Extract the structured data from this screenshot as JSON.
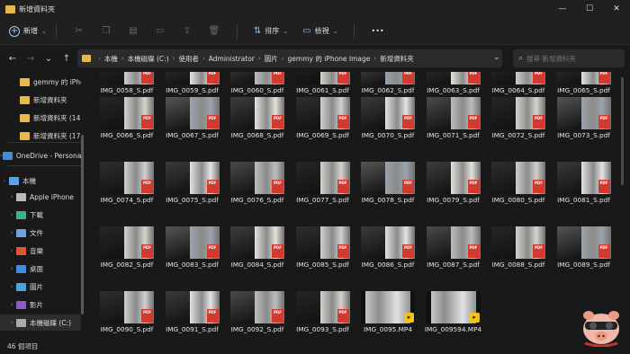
{
  "window": {
    "title": "新增資料夾",
    "minimize": "—",
    "maximize": "☐",
    "close": "✕"
  },
  "toolbar": {
    "new_label": "新增",
    "sort_label": "排序",
    "view_label": "檢視",
    "more_label": "•••"
  },
  "address": {
    "crumbs": [
      "本機",
      "本機磁碟 (C:)",
      "使用者",
      "Administrator",
      "圖片",
      "gemmy 的 iPhone Image",
      "新增資料夾"
    ],
    "search_placeholder": "搜尋 新增資料夾"
  },
  "sidebar": {
    "items": [
      {
        "label": "gemmy 的 iPhone",
        "icon": "folder-icon",
        "color": "#e8b94a"
      },
      {
        "label": "新增資料夾",
        "icon": "folder-icon",
        "color": "#e8b94a"
      },
      {
        "label": "新增資料夾 (14)",
        "icon": "folder-icon",
        "color": "#e8b94a"
      },
      {
        "label": "新增資料夾 (17)",
        "icon": "folder-icon",
        "color": "#e8b94a"
      },
      {
        "label": "OneDrive - Personal",
        "icon": "cloud-icon",
        "color": "#3d8ee0"
      },
      {
        "label": "本機",
        "icon": "pc-icon",
        "color": "#5aa4e6"
      },
      {
        "label": "Apple iPhone",
        "icon": "phone-icon",
        "color": "#bbbbbb"
      },
      {
        "label": "下載",
        "icon": "download-icon",
        "color": "#3fb08a"
      },
      {
        "label": "文件",
        "icon": "document-icon",
        "color": "#6ea2d8"
      },
      {
        "label": "音樂",
        "icon": "music-icon",
        "color": "#e0533d"
      },
      {
        "label": "桌面",
        "icon": "desktop-icon",
        "color": "#3d8ee0"
      },
      {
        "label": "圖片",
        "icon": "pictures-icon",
        "color": "#4aa3e0"
      },
      {
        "label": "影片",
        "icon": "video-icon",
        "color": "#8b5cc8"
      },
      {
        "label": "本機磁碟 (C:)",
        "icon": "drive-icon",
        "color": "#aaaaaa"
      }
    ]
  },
  "files": [
    {
      "name": "IMG_0058_S.pdf",
      "type": "pdf"
    },
    {
      "name": "IMG_0059_S.pdf",
      "type": "pdf"
    },
    {
      "name": "IMG_0060_S.pdf",
      "type": "pdf"
    },
    {
      "name": "IMG_0061_S.pdf",
      "type": "pdf"
    },
    {
      "name": "IMG_0062_S.pdf",
      "type": "pdf"
    },
    {
      "name": "IMG_0063_S.pdf",
      "type": "pdf"
    },
    {
      "name": "IMG_0064_S.pdf",
      "type": "pdf"
    },
    {
      "name": "IMG_0065_S.pdf",
      "type": "pdf"
    },
    {
      "name": "IMG_0066_S.pdf",
      "type": "pdf"
    },
    {
      "name": "IMG_0067_S.pdf",
      "type": "pdf"
    },
    {
      "name": "IMG_0068_S.pdf",
      "type": "pdf"
    },
    {
      "name": "IMG_0069_S.pdf",
      "type": "pdf"
    },
    {
      "name": "IMG_0070_S.pdf",
      "type": "pdf"
    },
    {
      "name": "IMG_0071_S.pdf",
      "type": "pdf"
    },
    {
      "name": "IMG_0072_S.pdf",
      "type": "pdf"
    },
    {
      "name": "IMG_0073_S.pdf",
      "type": "pdf"
    },
    {
      "name": "IMG_0074_S.pdf",
      "type": "pdf"
    },
    {
      "name": "IMG_0075_S.pdf",
      "type": "pdf"
    },
    {
      "name": "IMG_0076_S.pdf",
      "type": "pdf"
    },
    {
      "name": "IMG_0077_S.pdf",
      "type": "pdf"
    },
    {
      "name": "IMG_0078_S.pdf",
      "type": "pdf"
    },
    {
      "name": "IMG_0079_S.pdf",
      "type": "pdf"
    },
    {
      "name": "IMG_0080_S.pdf",
      "type": "pdf"
    },
    {
      "name": "IMG_0081_S.pdf",
      "type": "pdf"
    },
    {
      "name": "IMG_0082_S.pdf",
      "type": "pdf"
    },
    {
      "name": "IMG_0083_S.pdf",
      "type": "pdf"
    },
    {
      "name": "IMG_0084_S.pdf",
      "type": "pdf"
    },
    {
      "name": "IMG_0085_S.pdf",
      "type": "pdf"
    },
    {
      "name": "IMG_0086_S.pdf",
      "type": "pdf"
    },
    {
      "name": "IMG_0087_S.pdf",
      "type": "pdf"
    },
    {
      "name": "IMG_0088_S.pdf",
      "type": "pdf"
    },
    {
      "name": "IMG_0089_S.pdf",
      "type": "pdf"
    },
    {
      "name": "IMG_0090_S.pdf",
      "type": "pdf"
    },
    {
      "name": "IMG_0091_S.pdf",
      "type": "pdf"
    },
    {
      "name": "IMG_0092_S.pdf",
      "type": "pdf"
    },
    {
      "name": "IMG_0093_S.pdf",
      "type": "pdf"
    },
    {
      "name": "IMG_0095.MP4",
      "type": "mp4"
    },
    {
      "name": "IMG_009594.MP4",
      "type": "mp4"
    }
  ],
  "status": {
    "count": "46 個項目"
  },
  "colors": {
    "accent": "#9dc8ff",
    "pdf_badge": "#d23a30",
    "folder": "#e8b94a"
  }
}
